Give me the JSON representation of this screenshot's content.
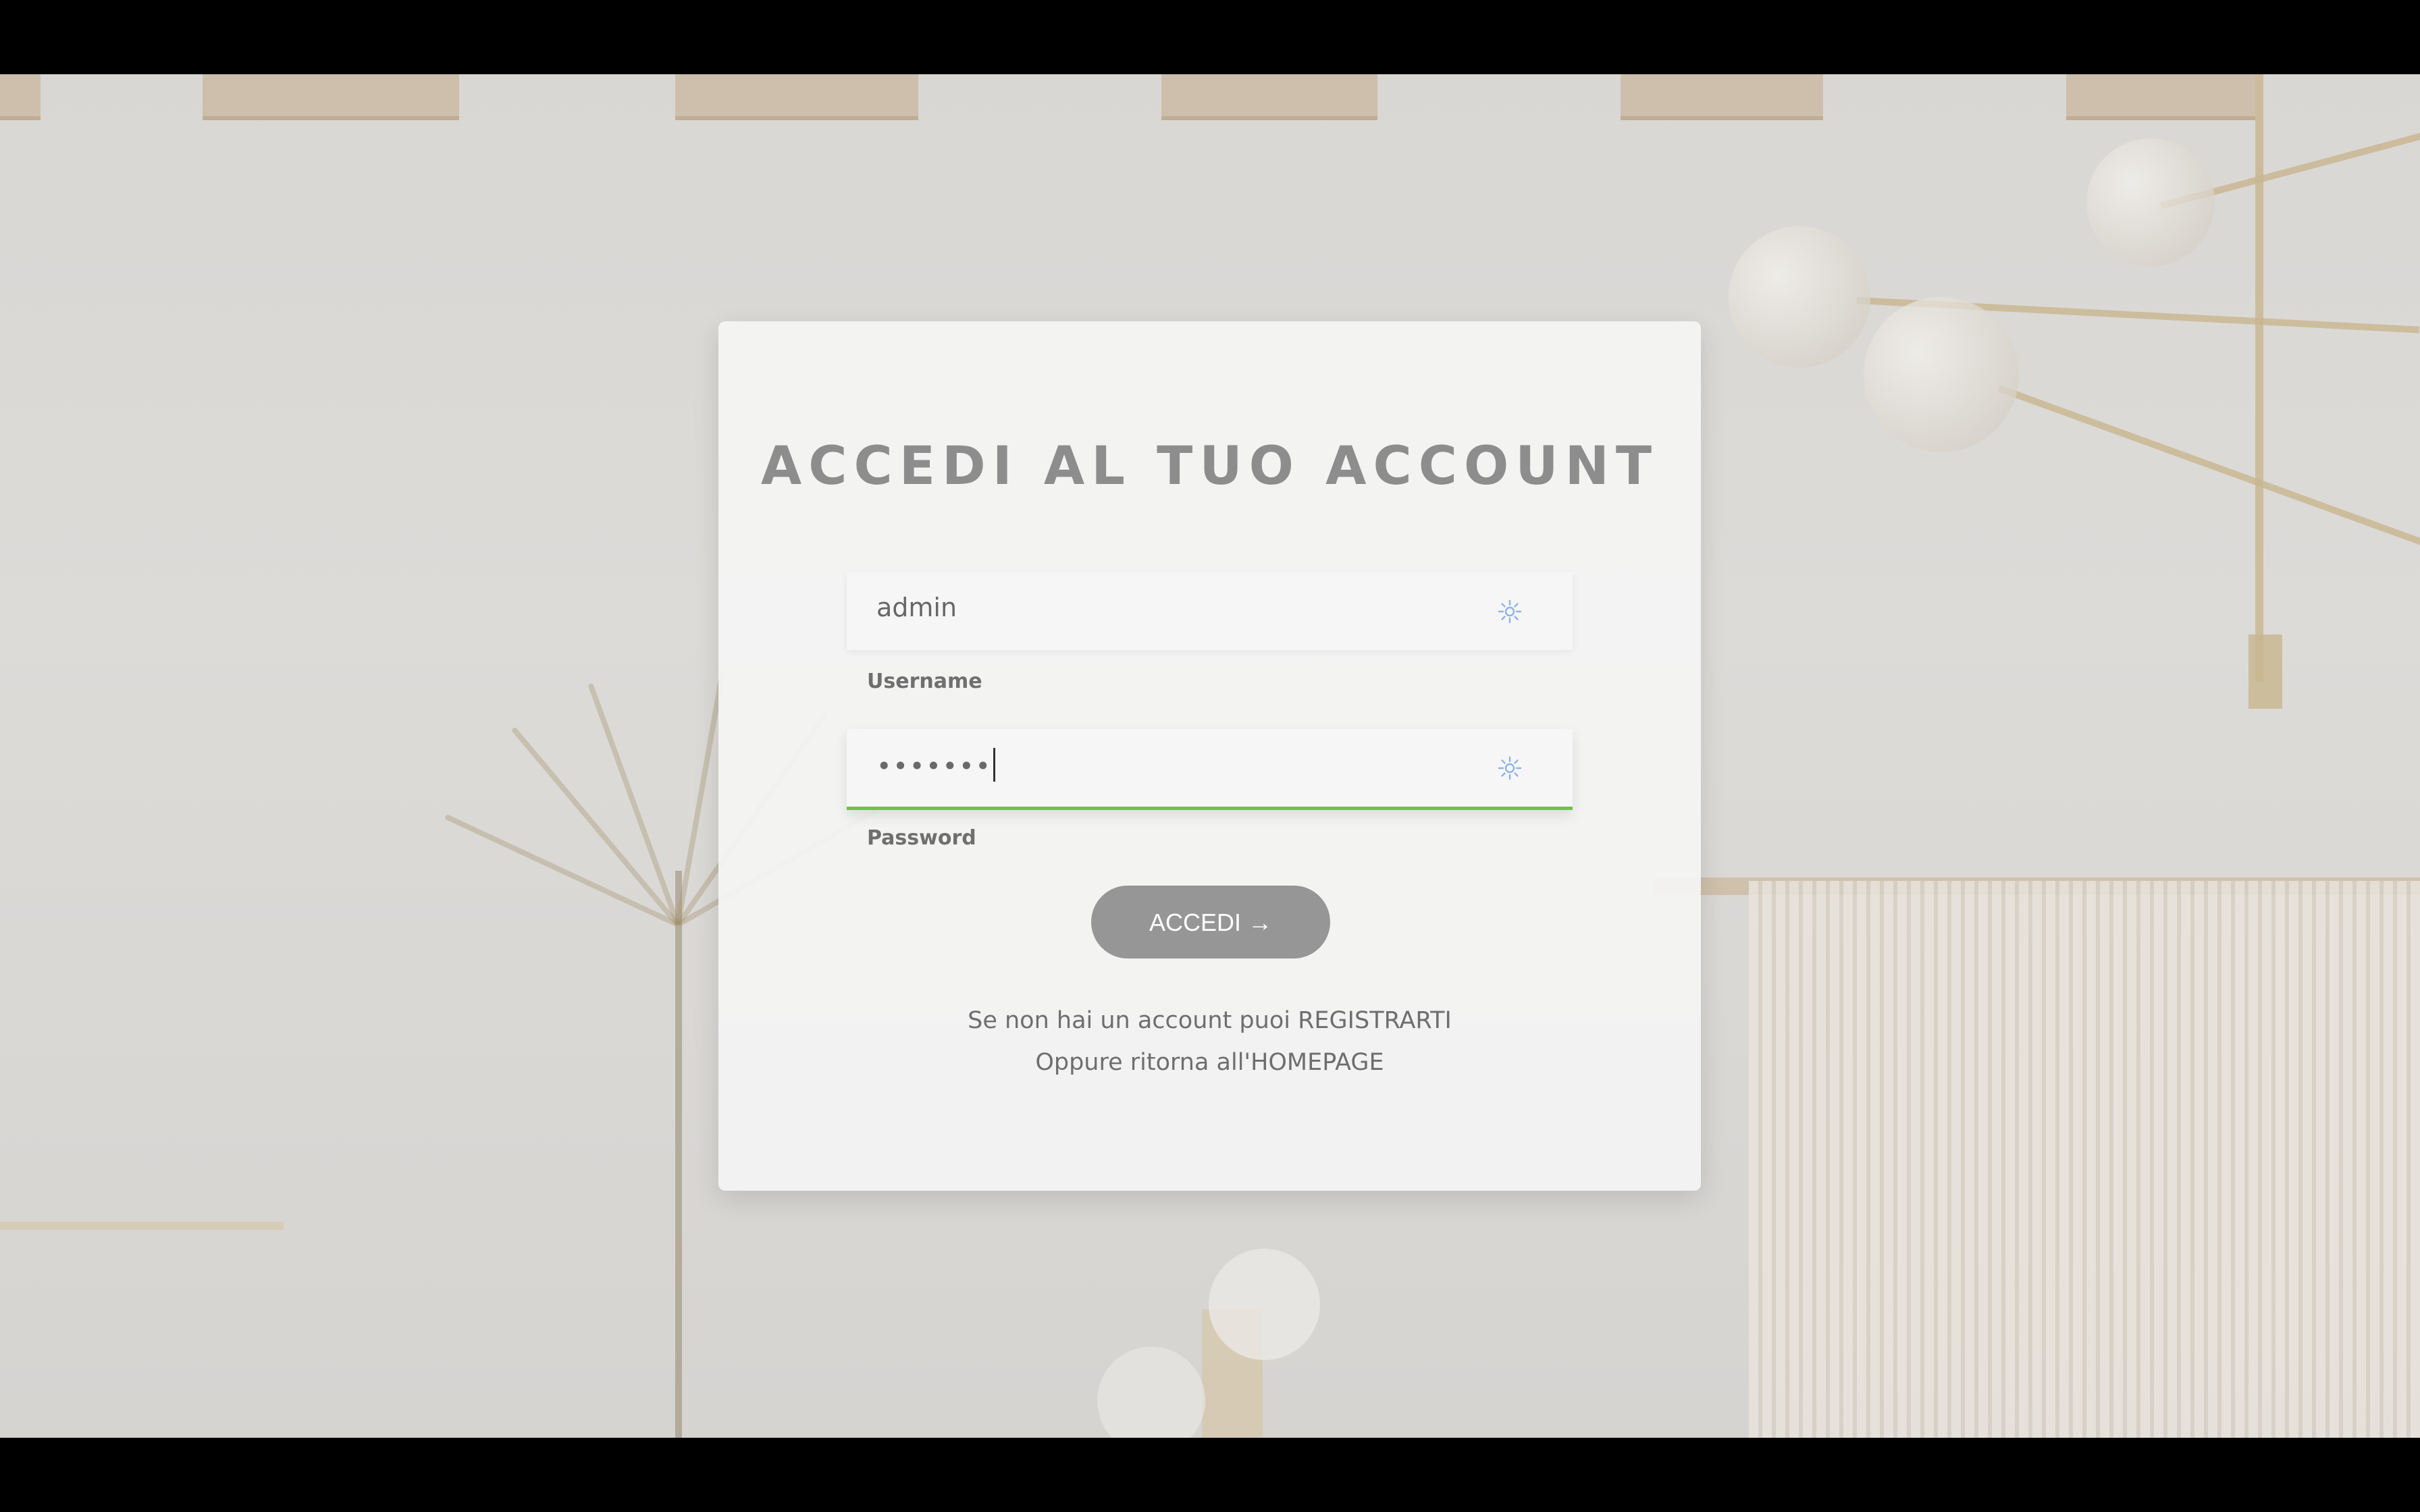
{
  "login": {
    "title": "ACCEDI AL TUO ACCOUNT",
    "username_value": "admin",
    "username_label": "Username",
    "password_mask": "•••••••",
    "password_label": "Password",
    "submit_label": "ACCEDI →",
    "register_prefix": "Se non hai un account puoi ",
    "register_link": "REGISTRARTI",
    "home_prefix": "Oppure ritorna all'",
    "home_link": "HOMEPAGE"
  },
  "colors": {
    "focus_border": "#6dc24b",
    "button": "#969696",
    "title": "#8d8d8d",
    "autofill_icon": "#8fb3e6"
  },
  "icons": {
    "username_field": "autofill-key-icon",
    "password_field": "autofill-key-icon"
  }
}
